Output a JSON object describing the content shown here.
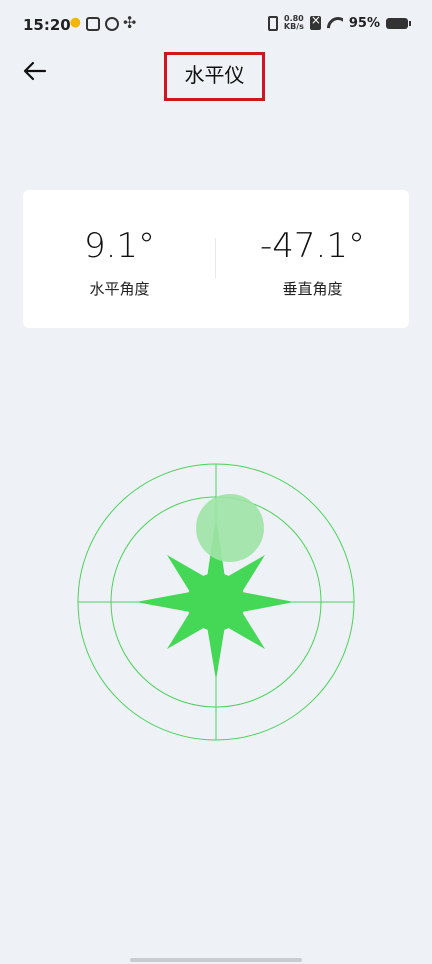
{
  "status_bar": {
    "time": "15:20",
    "speed_value": "0.80",
    "speed_unit": "KB/s",
    "battery": "95%",
    "icons": [
      "weather-icon",
      "box-icon",
      "loop-icon",
      "fan-icon",
      "vibrate-icon",
      "sim-off-icon",
      "wifi-icon",
      "battery-icon"
    ]
  },
  "app_bar": {
    "back_icon": "arrow-left-icon",
    "title": "水平仪",
    "title_highlight_color": "#d3141c"
  },
  "readings": {
    "horizontal": {
      "value": "9.1°",
      "label": "水平角度"
    },
    "vertical": {
      "value": "-47.1°",
      "label": "垂直角度"
    }
  },
  "level": {
    "line_color": "#4cd25a",
    "center_color": "#45d857",
    "bubble_color": "#9fe3a6",
    "bubble_offset": {
      "x": 9.1,
      "y": 47.1
    }
  }
}
